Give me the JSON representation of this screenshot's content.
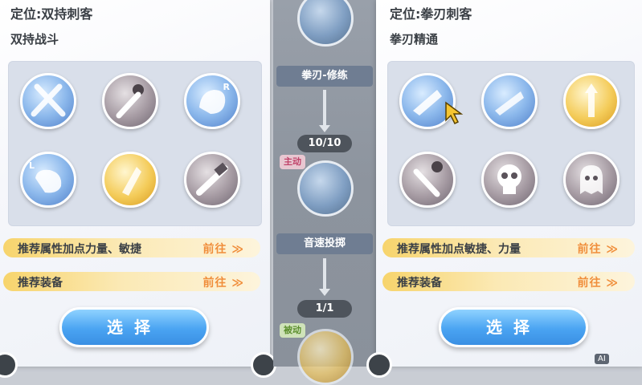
{
  "left_card": {
    "role": "定位:双持刺客",
    "skill_title": "双持战斗",
    "icons": [
      {
        "name": "crossed-swords-icon",
        "style": "blue"
      },
      {
        "name": "skull-sword-icon",
        "style": "gray"
      },
      {
        "name": "fist-r-icon",
        "style": "blue",
        "corner": "R"
      },
      {
        "name": "fist-l-icon",
        "style": "blue",
        "corner": "L"
      },
      {
        "name": "gold-fist-icon",
        "style": "gold"
      },
      {
        "name": "gray-blade-icon",
        "style": "gray"
      }
    ],
    "recommend_attr": "推荐属性加点力量、敏捷",
    "recommend_gear": "推荐装备",
    "goto_label": "前往 ≫",
    "select_label": "选择"
  },
  "center_column": {
    "node1_label": "拳刃-修练",
    "counter1": "10/10",
    "tag1": "主动",
    "node2_label": "音速投掷",
    "counter2": "1/1",
    "tag2": "被动"
  },
  "right_card": {
    "role": "定位:拳刃刺客",
    "skill_title": "拳刃精通",
    "icons": [
      {
        "name": "fist-blade-icon",
        "style": "blue"
      },
      {
        "name": "fist-blade-alt-icon",
        "style": "blue"
      },
      {
        "name": "gold-blade-up-icon",
        "style": "gold"
      },
      {
        "name": "skull-blade-icon",
        "style": "gray"
      },
      {
        "name": "skull-icon",
        "style": "gray"
      },
      {
        "name": "ghost-icon",
        "style": "gray"
      }
    ],
    "recommend_attr": "推荐属性加点敏捷、力量",
    "recommend_gear": "推荐装备",
    "goto_label": "前往 ≫",
    "select_label": "选择"
  },
  "badge": "AI"
}
